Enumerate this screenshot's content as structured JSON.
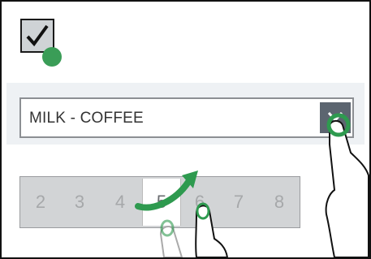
{
  "checkbox": {
    "checked": true,
    "icon": "checkmark-icon"
  },
  "dropdown": {
    "value": "MILK - COFFEE",
    "icon": "chevron-down-icon"
  },
  "picker": {
    "items": [
      "2",
      "3",
      "4",
      "5",
      "6",
      "7",
      "8"
    ],
    "selected": "5"
  },
  "colors": {
    "touch_indicator": "#3a9d57",
    "dropdown_button": "#5c6570",
    "picker_background": "#d2d4d6"
  }
}
